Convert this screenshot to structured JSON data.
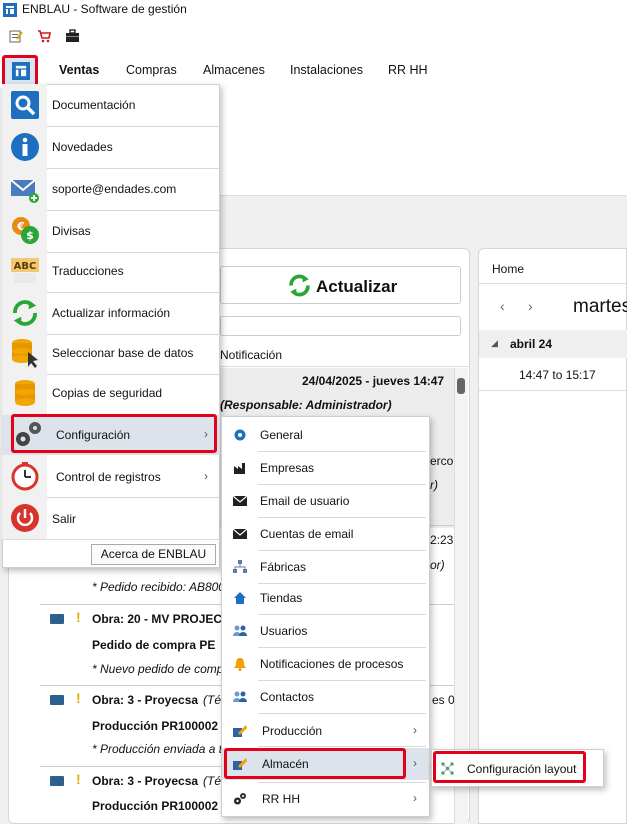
{
  "window": {
    "title": "ENBLAU - Software de gestión"
  },
  "tabs": [
    {
      "label": "Ventas",
      "active": true
    },
    {
      "label": "Compras"
    },
    {
      "label": "Almacenes"
    },
    {
      "label": "Instalaciones"
    },
    {
      "label": "RR HH"
    }
  ],
  "app_menu": {
    "items": [
      {
        "label": "Documentación",
        "icon": "search-icon"
      },
      {
        "label": "Novedades",
        "icon": "info-icon"
      },
      {
        "label": "soporte@endades.com",
        "icon": "mail-add-icon"
      },
      {
        "label": "Divisas",
        "icon": "currency-icon"
      },
      {
        "label": "Traducciones",
        "icon": "abc-icon"
      },
      {
        "label": "Actualizar información",
        "icon": "refresh-icon"
      },
      {
        "label": "Seleccionar base de datos",
        "icon": "database-select-icon"
      },
      {
        "label": "Copias de seguridad",
        "icon": "database-icon"
      },
      {
        "label": "Configuración",
        "icon": "gears-icon",
        "highlighted": true
      },
      {
        "label": "Control de registros",
        "icon": "timer-icon"
      },
      {
        "label": "Salir",
        "icon": "power-icon"
      }
    ],
    "about": "Acerca de ENBLAU"
  },
  "config_submenu": {
    "items": [
      {
        "label": "General",
        "icon": "gear-icon"
      },
      {
        "label": "Empresas",
        "icon": "factory-icon"
      },
      {
        "label": "Email de usuario",
        "icon": "envelope-icon"
      },
      {
        "label": "Cuentas de email",
        "icon": "envelope-icon"
      },
      {
        "label": "Fábricas",
        "icon": "hierarchy-icon"
      },
      {
        "label": "Tiendas",
        "icon": "home-icon"
      },
      {
        "label": "Usuarios",
        "icon": "users-icon"
      },
      {
        "label": "Notificaciones de procesos",
        "icon": "bell-icon"
      },
      {
        "label": "Contactos",
        "icon": "users-icon"
      },
      {
        "label": "Producción",
        "icon": "production-icon"
      },
      {
        "label": "Almacén",
        "icon": "warehouse-icon",
        "highlighted": true
      },
      {
        "label": "RR HH",
        "icon": "gears-icon"
      }
    ]
  },
  "almacen_submenu": {
    "items": [
      {
        "label": "Configuración layout",
        "icon": "layout-icon"
      }
    ]
  },
  "main": {
    "refresh_label": "Actualizar",
    "column_header": "Notificación",
    "rows": {
      "r1_date": "24/04/2025  - jueves  14:47",
      "r1_resp": "(Responsable: Administrador)",
      "r2_frag1": "ercol",
      "r2_frag2": "r)",
      "r3_frag1": "2:23",
      "r3_frag2": "or)",
      "r3_note": "* Pedido recibido: AB800",
      "r4_title": "Obra: 20 - MV PROJEC",
      "r4_line2": "Pedido de compra  PE",
      "r4_note": "* Nuevo pedido de comp",
      "r5_title": "Obra: 3 - Proyecsa",
      "r5_frag1": "(Té",
      "r5_frag2": "es 0",
      "r5_line2": "Producción  PR100002",
      "r5_note": "* Producción enviada a t",
      "r6_title": "Obra: 3 - Proyecsa",
      "r6_frag1": "(Té",
      "r6_line2": "Producción  PR100002"
    }
  },
  "calendar": {
    "home_tab": "Home",
    "prev": "‹",
    "next": "›",
    "day_label": "martes",
    "month_label": "abril 24",
    "slot": "14:47 to 15:17"
  },
  "colors": {
    "highlight": "#e3001b",
    "icon_blue": "#1e6fc0",
    "menu_selected": "#dde3ea"
  }
}
